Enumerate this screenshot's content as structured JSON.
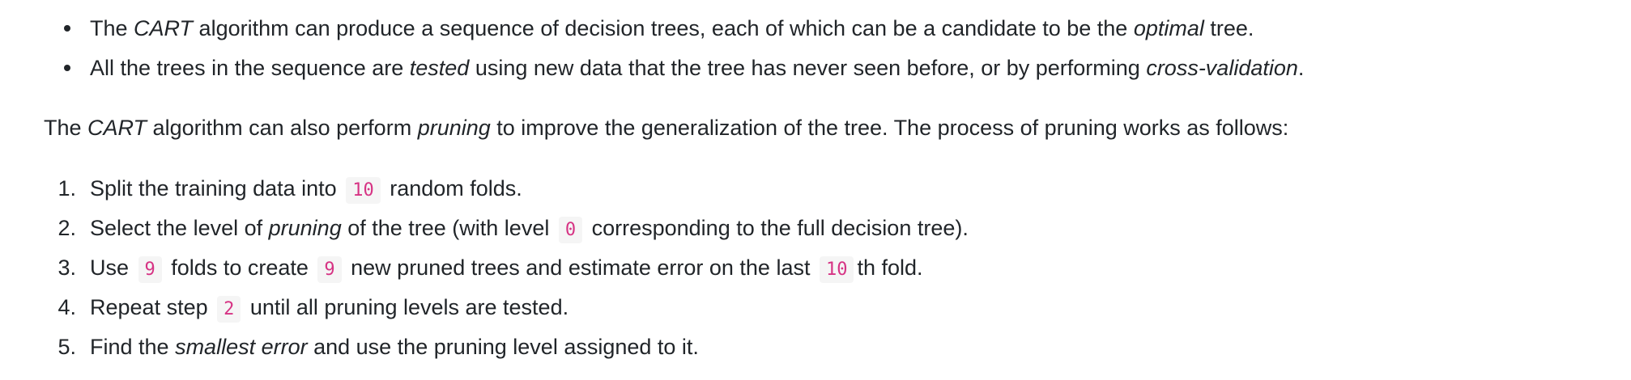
{
  "bullets": [
    {
      "t1": "The ",
      "em1": "CART",
      "t2": " algorithm can produce a sequence of decision trees, each of which can be a candidate to be the ",
      "em2": "optimal",
      "t3": " tree."
    },
    {
      "t1": "All the trees in the sequence are ",
      "em1": "tested",
      "t2": " using new data that the tree has never seen before, or by performing ",
      "em2": "cross-validation",
      "t3": "."
    }
  ],
  "paragraph": {
    "t1": "The ",
    "em1": "CART",
    "t2": " algorithm can also perform ",
    "em2": "pruning",
    "t3": " to improve the generalization of the tree. The process of pruning works as follows:"
  },
  "steps": [
    {
      "marker": "1.",
      "t1": "Split the training data into ",
      "code1": "10",
      "t2": " random folds."
    },
    {
      "marker": "2.",
      "t1": "Select the level of ",
      "em1": "pruning",
      "t2": " of the tree (with level ",
      "code1": "0",
      "t3": " corresponding to the full decision tree)."
    },
    {
      "marker": "3.",
      "t1": "Use ",
      "code1": "9",
      "t2": " folds to create ",
      "code2": "9",
      "t3": " new pruned trees and estimate error on the last ",
      "code3": "10",
      "t4": "th fold."
    },
    {
      "marker": "4.",
      "t1": "Repeat step ",
      "code1": "2",
      "t2": " until all pruning levels are tested."
    },
    {
      "marker": "5.",
      "t1": "Find the ",
      "em1": "smallest error",
      "t2": " and use the pruning level assigned to it."
    }
  ]
}
